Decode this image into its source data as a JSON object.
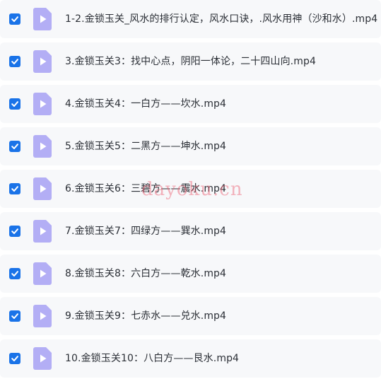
{
  "files": [
    {
      "name": "1-2.金锁玉关_风水的排行认定，风水口诀，.风水用神（沙和水）.mp4",
      "checked": true
    },
    {
      "name": "3.金锁玉关3：找中心点，阴阳一体论，二十四山向.mp4",
      "checked": true
    },
    {
      "name": "4.金锁玉关4：一白方——坎水.mp4",
      "checked": true
    },
    {
      "name": "5.金锁玉关5：二黑方——坤水.mp4",
      "checked": true
    },
    {
      "name": "6.金锁玉关6：三碧方——震水.mp4",
      "checked": true
    },
    {
      "name": "7.金锁玉关7：四绿方——巽水.mp4",
      "checked": true
    },
    {
      "name": "8.金锁玉关8：六白方——乾水.mp4",
      "checked": true
    },
    {
      "name": "9.金锁玉关9：七赤水——兑水.mp4",
      "checked": true
    },
    {
      "name": "10.金锁玉关10：八白方——艮水.mp4",
      "checked": true
    }
  ],
  "watermark": "dayoku.cn",
  "colors": {
    "checkbox": "#1a73e8",
    "file_icon": "#b3aef5",
    "row_background": "#f7f8fa",
    "text": "#2b2f36"
  },
  "icons": {
    "checkbox": "checkmark-icon",
    "file": "video-file-icon"
  }
}
